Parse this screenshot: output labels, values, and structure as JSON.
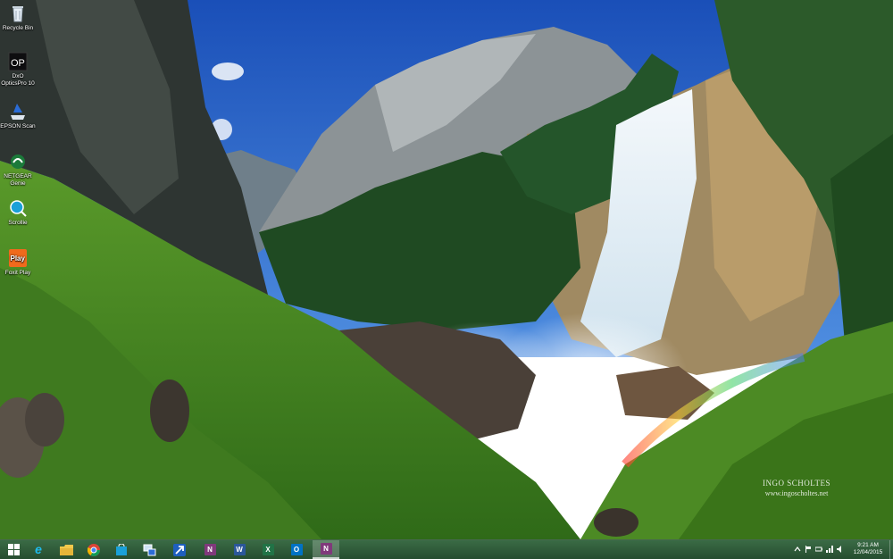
{
  "desktop": {
    "icons": [
      {
        "label": "Recycle Bin"
      },
      {
        "label": "DxO OpticsPro 10"
      },
      {
        "label": "EPSON Scan"
      },
      {
        "label": "NETGEAR Genie"
      },
      {
        "label": "Scrollie"
      },
      {
        "label": "Foxit Play"
      }
    ],
    "watermark_line1": "INGO SCHOLTES",
    "watermark_line2": "www.ingoscholtes.net"
  },
  "taskbar": {
    "buttons": [
      {
        "name": "start",
        "icon": "windows-logo-icon"
      },
      {
        "name": "internet-explorer",
        "icon": "internet-explorer-icon",
        "glyph": "e"
      },
      {
        "name": "file-explorer",
        "icon": "folder-icon"
      },
      {
        "name": "chrome",
        "icon": "chrome-icon"
      },
      {
        "name": "store",
        "icon": "store-icon"
      },
      {
        "name": "network",
        "icon": "computer-network-icon"
      },
      {
        "name": "app-arrow",
        "icon": "arrow-app-icon"
      },
      {
        "name": "onenote",
        "icon": "onenote-icon",
        "glyph": "N"
      },
      {
        "name": "word",
        "icon": "word-icon",
        "glyph": "W"
      },
      {
        "name": "excel",
        "icon": "excel-icon",
        "glyph": "X"
      },
      {
        "name": "outlook",
        "icon": "outlook-icon",
        "glyph": "O"
      },
      {
        "name": "onenote-active",
        "icon": "onenote-icon",
        "glyph": "N"
      }
    ],
    "clock_time": "9:21 AM",
    "clock_date": "12/04/2015"
  },
  "colors": {
    "taskbar": "#2d5a38",
    "word": "#2b579a",
    "excel": "#217346",
    "outlook": "#0072c6",
    "onenote": "#80397b",
    "ie": "#1ebbee"
  }
}
